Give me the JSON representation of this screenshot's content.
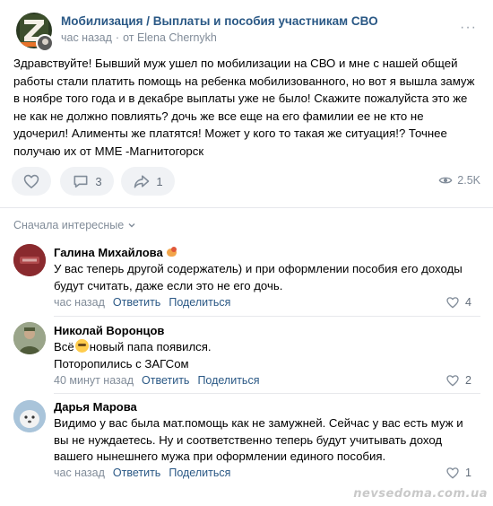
{
  "post": {
    "group_title": "Мобилизация / Выплаты и пособия участникам СВО",
    "time": "час назад",
    "from_label": "от Elena Chernykh",
    "more_label": "···",
    "text": "Здравствуйте! Бывший муж ушел по мобилизации на СВО и мне с нашей общей работы стали платить помощь на ребенка мобилизованного, но вот я вышла замуж в ноябре того года и в декабре выплаты уже не было! Скажите пожалуйста это же не как не должно повлиять? дочь же все еще на его фамилии ее не кто не удочерил! Алименты же платятся! Может у кого то такая же ситуация!? Точнее получаю их от МME -Магнитогорск",
    "comments_count": "3",
    "shares_count": "1",
    "views": "2.5K"
  },
  "sort_label": "Сначала интересные",
  "comments": [
    {
      "name": "Галина Михайлова",
      "text": "У вас теперь другой содержатель) и при оформлении пособия его доходы будут считать, даже если это не его дочь.",
      "time": "час назад",
      "reply": "Ответить",
      "share": "Поделиться",
      "likes": "4"
    },
    {
      "name": "Николай Воронцов",
      "text_before": "Всё",
      "text_after": "новый папа появился.",
      "text_line2": "Поторопились с ЗАГСом",
      "time": "40 минут назад",
      "reply": "Ответить",
      "share": "Поделиться",
      "likes": "2"
    },
    {
      "name": "Дарья Марова",
      "text": "Видимо у вас была мат.помощь как не замужней. Сейчас у вас есть муж и вы не нуждаетесь. Ну и соответственно теперь будут учитывать доход вашего нынешнего мужа при оформлении единого пособия.",
      "time": "час назад",
      "reply": "Ответить",
      "share": "Поделиться",
      "likes": "1"
    }
  ],
  "watermark": "nevsedoma.com.ua",
  "colors": {
    "link": "#2a5885",
    "muted": "#818c99",
    "button_bg": "#f0f2f5",
    "divider": "#e7e8ec"
  }
}
